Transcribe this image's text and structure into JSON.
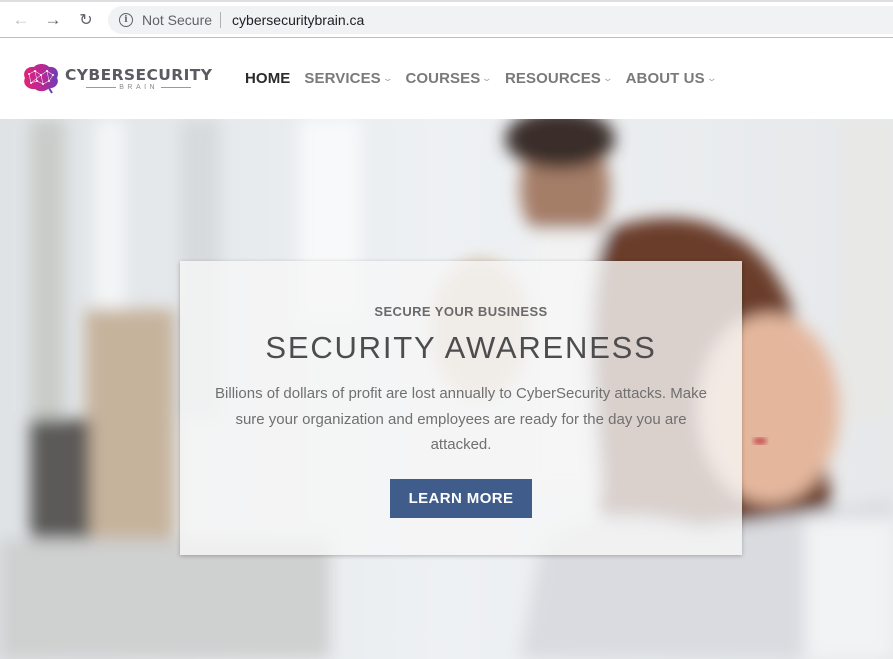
{
  "browser": {
    "back_icon": "←",
    "forward_icon": "→",
    "reload_icon": "↻",
    "info_icon": "i",
    "security_label": "Not Secure",
    "url": "cybersecuritybrain.ca"
  },
  "header": {
    "logo": {
      "title": "CYBERSECURITY",
      "subtitle": "BRAIN"
    },
    "nav": [
      {
        "label": "HOME",
        "active": true,
        "dropdown": false
      },
      {
        "label": "SERVICES",
        "active": false,
        "dropdown": true
      },
      {
        "label": "COURSES",
        "active": false,
        "dropdown": true
      },
      {
        "label": "RESOURCES",
        "active": false,
        "dropdown": true
      },
      {
        "label": "ABOUT US",
        "active": false,
        "dropdown": true
      }
    ],
    "chevron_icon": "⌄"
  },
  "hero": {
    "eyebrow": "SECURE YOUR BUSINESS",
    "headline": "SECURITY AWARENESS",
    "body": "Billions of dollars of profit are lost annually to CyberSecurity attacks. Make sure your organization and employees are ready for the day you are attacked.",
    "cta_label": "LEARN MORE"
  },
  "colors": {
    "cta": "#3f5c8a",
    "nav_active": "#2b2b2b",
    "nav_inactive": "#7a7a7a",
    "logo_magenta": "#d6247a",
    "logo_purple": "#7b3fb0"
  }
}
